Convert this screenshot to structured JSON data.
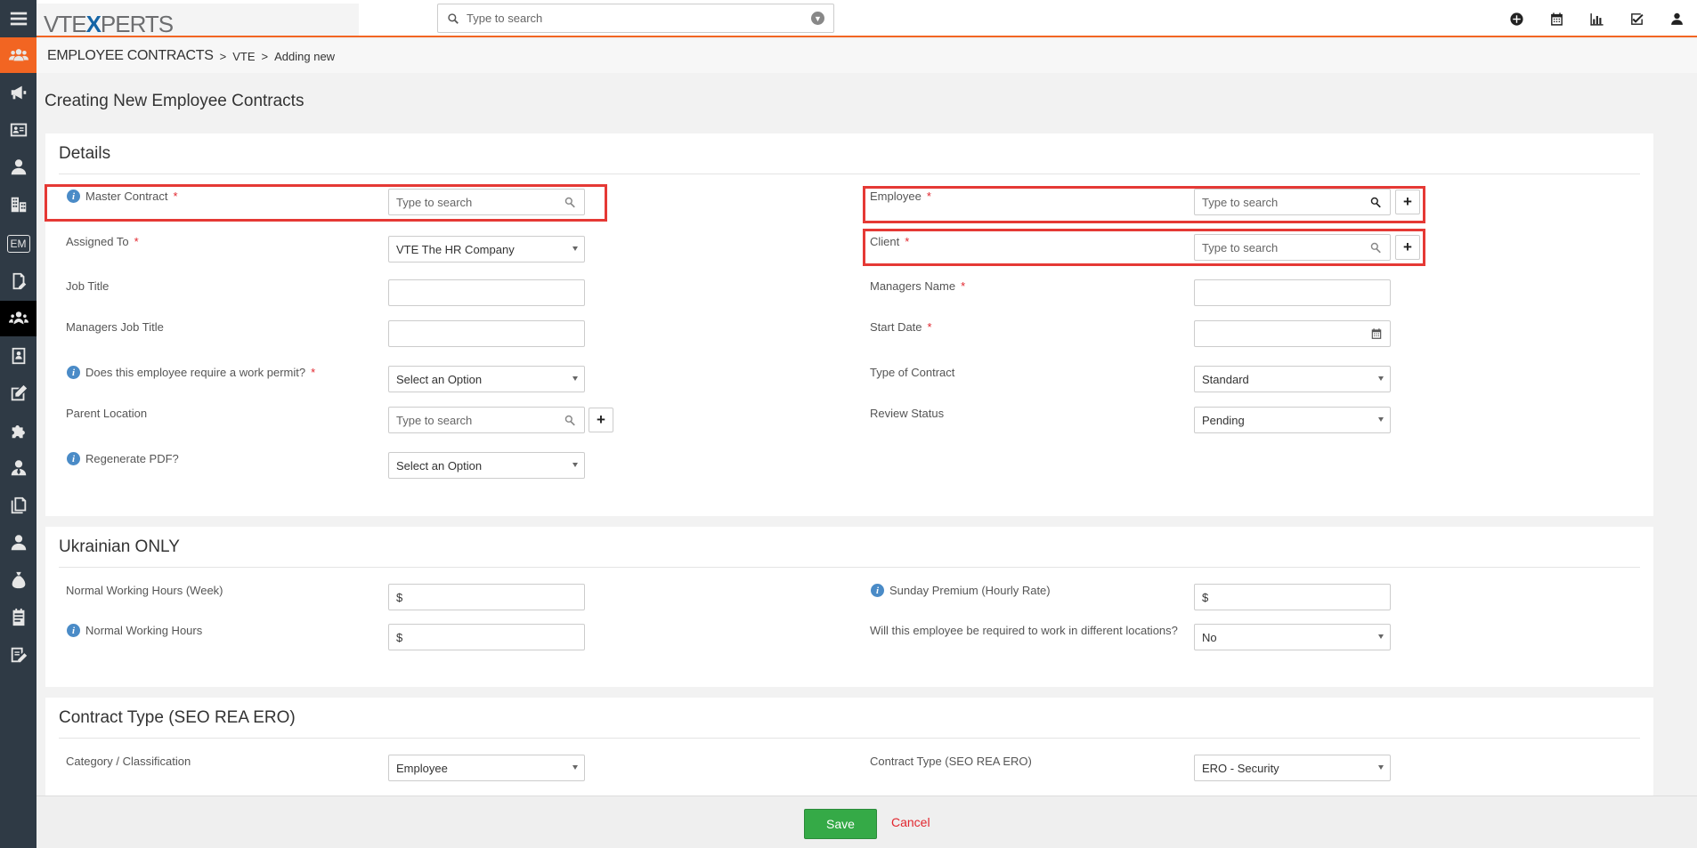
{
  "app": {
    "logo_pre": "VTE",
    "logo_x": "X",
    "logo_post": "PERTS",
    "search_placeholder": "Type to search",
    "accent_color": "#f26522"
  },
  "sidebar": {
    "items": [
      {
        "icon": "menu-icon"
      },
      {
        "icon": "users-group-icon"
      },
      {
        "icon": "megaphone-icon"
      },
      {
        "icon": "contact-card-icon"
      },
      {
        "icon": "person-icon"
      },
      {
        "icon": "building-icon"
      },
      {
        "icon": "em-badge-icon",
        "label": "EM"
      },
      {
        "icon": "document-edit-icon"
      },
      {
        "icon": "employee-contracts-icon"
      },
      {
        "icon": "address-book-icon"
      },
      {
        "icon": "pencil-square-icon"
      },
      {
        "icon": "puzzle-icon"
      },
      {
        "icon": "user-tie-icon"
      },
      {
        "icon": "documents-icon"
      },
      {
        "icon": "user-icon"
      },
      {
        "icon": "money-bag-icon"
      },
      {
        "icon": "notepad-icon"
      },
      {
        "icon": "form-edit-icon"
      }
    ]
  },
  "breadcrumb": {
    "module": "EMPLOYEE CONTRACTS",
    "sep": ">",
    "items": [
      "VTE",
      "Adding new"
    ]
  },
  "page": {
    "title": "Creating New Employee Contracts"
  },
  "details": {
    "title": "Details",
    "master_contract": {
      "label": "Master Contract",
      "required": "*",
      "placeholder": "Type to search"
    },
    "employee": {
      "label": "Employee",
      "required": "*",
      "placeholder": "Type to search"
    },
    "assigned_to": {
      "label": "Assigned To",
      "required": "*",
      "value": "VTE The HR Company"
    },
    "client": {
      "label": "Client",
      "required": "*",
      "placeholder": "Type to search"
    },
    "job_title": {
      "label": "Job Title",
      "value": ""
    },
    "managers_name": {
      "label": "Managers Name",
      "required": "*",
      "value": ""
    },
    "managers_job_title": {
      "label": "Managers Job Title",
      "value": ""
    },
    "start_date": {
      "label": "Start Date",
      "required": "*",
      "value": ""
    },
    "work_permit": {
      "label": "Does this employee require a work permit?",
      "required": "*",
      "value": "Select an Option"
    },
    "type_of_contract": {
      "label": "Type of Contract",
      "value": "Standard"
    },
    "parent_location": {
      "label": "Parent Location",
      "placeholder": "Type to search"
    },
    "review_status": {
      "label": "Review Status",
      "value": "Pending"
    },
    "regenerate_pdf": {
      "label": "Regenerate PDF?",
      "value": "Select an Option"
    }
  },
  "ukrainian": {
    "title": "Ukrainian ONLY",
    "normal_hours_week": {
      "label": "Normal Working Hours (Week)",
      "value": "$"
    },
    "sunday_premium": {
      "label": "Sunday Premium (Hourly Rate)",
      "value": "$"
    },
    "normal_hours": {
      "label": "Normal Working Hours",
      "value": "$"
    },
    "diff_locations": {
      "label": "Will this employee be required to work in different locations?",
      "value": "No"
    }
  },
  "contract_type": {
    "title": "Contract Type (SEO REA ERO)",
    "category": {
      "label": "Category / Classification",
      "value": "Employee"
    },
    "contract_type": {
      "label": "Contract Type (SEO REA ERO)",
      "value": "ERO - Security"
    }
  },
  "footer": {
    "save_label": "Save",
    "cancel_label": "Cancel"
  },
  "info_glyph": "i",
  "plus_glyph": "+"
}
